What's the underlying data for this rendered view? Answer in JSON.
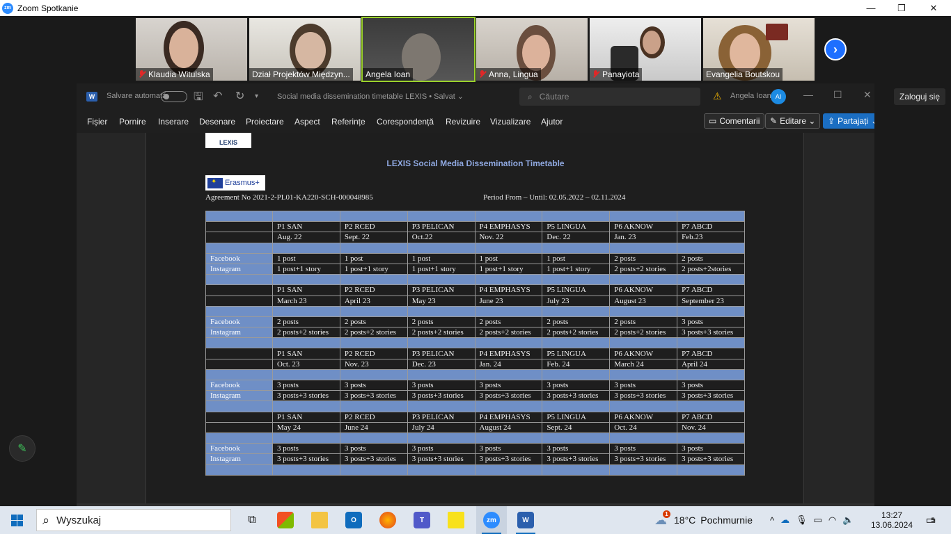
{
  "zoom": {
    "window_title": "Zoom Spotkanie",
    "logo_text": "zm",
    "controls": {
      "minimize": "—",
      "restore": "❐",
      "close": "✕"
    },
    "participants": [
      {
        "name": "Klaudia Witulska",
        "muted": true
      },
      {
        "name": "Dział Projektów Międzyn...",
        "muted": false
      },
      {
        "name": "Angela Ioan",
        "muted": false
      },
      {
        "name": "Anna, Lingua",
        "muted": true
      },
      {
        "name": "Panayiota",
        "muted": true
      },
      {
        "name": "Evangelia Boutskou",
        "muted": false
      }
    ],
    "next_label": "›",
    "sign_in": "Zaloguj się",
    "annotate_icon": "pencil-icon"
  },
  "word": {
    "app_letter": "W",
    "autosave_label": "Salvare automată",
    "doc_title": "Social media dissemination  timetable LEXIS • Salvat ⌄",
    "search_placeholder": "Căutare",
    "user_name": "Angela Ioan",
    "user_initials": "AI",
    "menu": [
      "Fișier",
      "Pornire",
      "Inserare",
      "Desenare",
      "Proiectare",
      "Aspect",
      "Referințe",
      "Corespondență",
      "Revizuire",
      "Vizualizare",
      "Ajutor"
    ],
    "comments_label": "Comentarii",
    "edit_label": "Editare ⌄",
    "share_label": "Partajați",
    "share_chevron": "⌄"
  },
  "document": {
    "logo_text": "LEXIS",
    "heading": "LEXIS Social Media Dissemination Timetable",
    "erasmus_text": "Erasmus+",
    "agreement": "Agreement No 2021-2-PL01-KA220-SCH-000048985",
    "period": "Period From – Until: 02.05.2022 – 02.11.2024",
    "blocks": [
      {
        "partners": [
          "P1 SAN",
          "P2 RCED",
          "P3 PELICAN",
          "P4 EMPHASYS",
          "P5 LINGUA",
          "P6 AKNOW",
          "P7 ABCD"
        ],
        "dates": [
          "Aug. 22",
          "Sept. 22",
          "Oct.22",
          "Nov. 22",
          "Dec. 22",
          "Jan. 23",
          "Feb.23"
        ],
        "facebook_label": "Facebook",
        "facebook": [
          "1 post",
          "1 post",
          "1 post",
          "1 post",
          "1 post",
          "2 posts",
          "2 posts"
        ],
        "instagram_label": "Instagram",
        "instagram": [
          "1 post+1 story",
          "1 post+1 story",
          "1 post+1 story",
          "1 post+1 story",
          "1 post+1 story",
          "2 posts+2 stories",
          "2 posts+2stories"
        ]
      },
      {
        "partners": [
          "P1 SAN",
          "P2 RCED",
          "P3 PELICAN",
          "P4 EMPHASYS",
          "P5 LINGUA",
          "P6 AKNOW",
          "P7 ABCD"
        ],
        "dates": [
          "March 23",
          "April 23",
          "May 23",
          "June 23",
          "July 23",
          "August 23",
          "September 23"
        ],
        "facebook_label": "Facebook",
        "facebook": [
          "2 posts",
          "2 posts",
          "2 posts",
          "2 posts",
          "2 posts",
          "2 posts",
          "3 posts"
        ],
        "instagram_label": "Instagram",
        "instagram": [
          "2 posts+2 stories",
          "2 posts+2 stories",
          "2 posts+2 stories",
          "2 posts+2 stories",
          "2 posts+2 stories",
          "2 posts+2 stories",
          "3 posts+3 stories"
        ]
      },
      {
        "partners": [
          "P1 SAN",
          "P2 RCED",
          "P3 PELICAN",
          "P4 EMPHASYS",
          "P5 LINGUA",
          "P6 AKNOW",
          "P7 ABCD"
        ],
        "dates": [
          "Oct. 23",
          "Nov. 23",
          "Dec. 23",
          "Jan. 24",
          "Feb. 24",
          "March 24",
          "April 24"
        ],
        "facebook_label": "Facebook",
        "facebook": [
          "3 posts",
          "3 posts",
          "3 posts",
          "3 posts",
          "3 posts",
          "3 posts",
          "3 posts"
        ],
        "instagram_label": "Instagram",
        "instagram": [
          "3 posts+3 stories",
          "3 posts+3 stories",
          "3 posts+3 stories",
          "3 posts+3 stories",
          "3 posts+3 stories",
          "3 posts+3 stories",
          "3 posts+3 stories"
        ]
      },
      {
        "partners": [
          "P1 SAN",
          "P2 RCED",
          "P3 PELICAN",
          "P4 EMPHASYS",
          "P5 LINGUA",
          "P6 AKNOW",
          "P7 ABCD"
        ],
        "dates": [
          "May 24",
          "June 24",
          "July 24",
          "August 24",
          "Sept. 24",
          "Oct. 24",
          "Nov. 24"
        ],
        "facebook_label": "Facebook",
        "facebook": [
          "3 posts",
          "3 posts",
          "3 posts",
          "3 posts",
          "3 posts",
          "3 posts",
          "3 posts"
        ],
        "instagram_label": "Instagram",
        "instagram": [
          "3 posts+3 stories",
          "3 posts+3 stories",
          "3 posts+3 stories",
          "3 posts+3 stories",
          "3 posts+3 stories",
          "3 posts+3 stories",
          "3 posts+3 stories"
        ]
      }
    ]
  },
  "taskbar": {
    "search_placeholder": "Wyszukaj",
    "weather_temp": "18°C",
    "weather_desc": "Pochmurnie",
    "weather_badge": "1",
    "time": "13:27",
    "date": "13.06.2024",
    "notifications": "5",
    "apps": [
      "task-view",
      "microsoft-store",
      "file-explorer",
      "outlook",
      "firefox",
      "teams",
      "sticky-notes",
      "zoom",
      "word"
    ]
  },
  "colors": {
    "table_blue": "#6f8fc6",
    "heading_blue": "#8fa8e0",
    "zoom_blue": "#2d8cff",
    "word_blue": "#1b6ec2",
    "mute_red": "#e02828"
  }
}
